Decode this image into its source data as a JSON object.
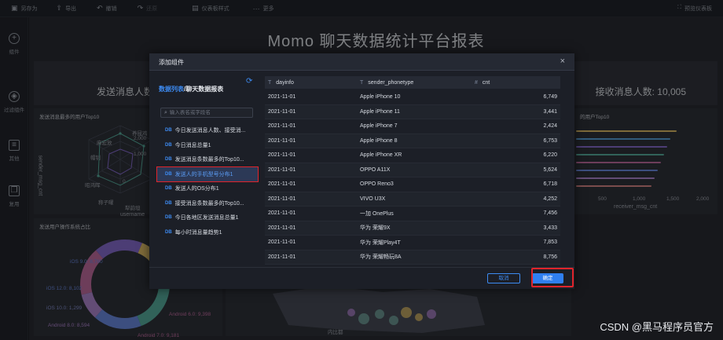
{
  "toolbar": {
    "items": [
      {
        "label": "另存为",
        "icon": "save-icon"
      },
      {
        "label": "导出",
        "icon": "export-icon"
      },
      {
        "label": "撤销",
        "icon": "undo-icon"
      },
      {
        "label": "还原",
        "icon": "redo-icon"
      },
      {
        "label": "仪表板样式",
        "icon": "style-icon"
      },
      {
        "label": "更多",
        "icon": "more-icon"
      }
    ],
    "preview_label": "预览仪表板"
  },
  "rail": {
    "items": [
      {
        "label": "组件",
        "icon": "plus-icon"
      },
      {
        "label": "过滤组件",
        "icon": "filter-icon"
      },
      {
        "label": "其他",
        "icon": "other-icon"
      },
      {
        "label": "复用",
        "icon": "reuse-icon"
      }
    ]
  },
  "dashboard": {
    "title": "Momo 聊天数据统计平台报表",
    "stat_left": "发送消息人数:",
    "stat_right": "接收消息人数: 10,005",
    "panel_top_left_title": "发送消息最多的用户Top10",
    "panel_top_right_title": "的用户Top10",
    "panel_bottom_left_title": "发送用户操作系统占比",
    "radar": {
      "y_title": "sender_msg_cnt",
      "x_title": "username",
      "axis_labels": [
        "养昆鸡",
        "麻宏放",
        "帽钊",
        "昭鸿晖",
        "称子曜",
        "犁韵坦"
      ],
      "ticks": [
        "2,000",
        "1,000",
        "0"
      ]
    },
    "bars": {
      "x_title": "receiver_msg_cnt",
      "ticks": [
        "500",
        "1,000",
        "1,500",
        "2,000"
      ]
    },
    "donut": {
      "labels": [
        "iOS 9.0: 8,760",
        "iOS 12.0: 8,102",
        "iOS 10.0: 1,299",
        "Android 8.0: 8,594",
        "Android 7.0: 9,181",
        "Android 6.0: 9,398"
      ]
    },
    "map_label": "内比都"
  },
  "dialog": {
    "title": "添加组件",
    "crumb_root": "数据列表",
    "crumb_sep": "/",
    "crumb_leaf": "聊天数据报表",
    "search_placeholder": "输入表名或字段名",
    "tables": [
      "今日发送消息人数、接受消...",
      "今日消息总量1",
      "发送消息条数最多的Top10...",
      "发送人的手机型号分布1",
      "发送人的OS分布1",
      "接受消息条数最多的Top10...",
      "今日各地区发送消息总量1",
      "每小时消息量趋势1"
    ],
    "active_table": "发送人的手机型号分布1",
    "columns": [
      {
        "type": "T",
        "name": "dayinfo"
      },
      {
        "type": "T",
        "name": "sender_phonetype"
      },
      {
        "type": "#",
        "name": "cnt"
      }
    ],
    "rows": [
      [
        "2021-11-01",
        "Apple iPhone 10",
        "6,749"
      ],
      [
        "2021-11-01",
        "Apple iPhone 11",
        "3,441"
      ],
      [
        "2021-11-01",
        "Apple iPhone 7",
        "2,424"
      ],
      [
        "2021-11-01",
        "Apple iPhone 8",
        "6,753"
      ],
      [
        "2021-11-01",
        "Apple iPhone XR",
        "6,220"
      ],
      [
        "2021-11-01",
        "OPPO A11X",
        "5,624"
      ],
      [
        "2021-11-01",
        "OPPO Reno3",
        "6,718"
      ],
      [
        "2021-11-01",
        "VIVO U3X",
        "4,252"
      ],
      [
        "2021-11-01",
        "一加 OnePlus",
        "7,456"
      ],
      [
        "2021-11-01",
        "华为 荣耀9X",
        "3,433"
      ],
      [
        "2021-11-01",
        "华为 荣耀Play4T",
        "7,853"
      ],
      [
        "2021-11-01",
        "华为 荣耀畅玩8A",
        "8,756"
      ]
    ],
    "cancel_label": "取消",
    "ok_label": "确定"
  },
  "watermark": "CSDN @黑马程序员官方",
  "colors": {
    "accent": "#3d8bf2",
    "highlight": "#e0242b"
  }
}
